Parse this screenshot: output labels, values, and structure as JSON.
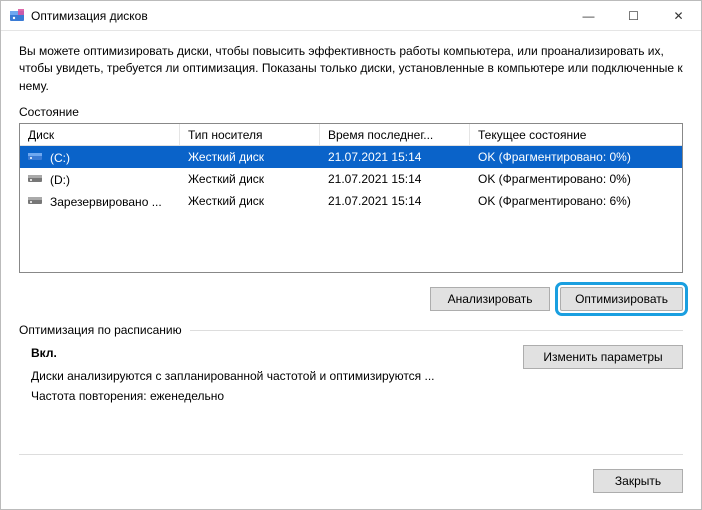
{
  "window": {
    "title": "Оптимизация дисков",
    "minimize_glyph": "—",
    "maximize_glyph": "☐",
    "close_glyph": "✕"
  },
  "description": "Вы можете оптимизировать диски, чтобы повысить эффективность работы компьютера, или проанализировать их, чтобы увидеть, требуется ли оптимизация. Показаны только диски, установленные в компьютере или подключенные к нему.",
  "status_label": "Состояние",
  "columns": {
    "disk": "Диск",
    "media": "Тип носителя",
    "time": "Время последнег...",
    "status": "Текущее состояние"
  },
  "rows": [
    {
      "icon": "drive-c",
      "disk": "(C:)",
      "media": "Жесткий диск",
      "time": "21.07.2021 15:14",
      "status": "OK (Фрагментировано: 0%)",
      "selected": true
    },
    {
      "icon": "drive",
      "disk": "(D:)",
      "media": "Жесткий диск",
      "time": "21.07.2021 15:14",
      "status": "OK (Фрагментировано: 0%)",
      "selected": false
    },
    {
      "icon": "drive",
      "disk": "Зарезервировано ...",
      "media": "Жесткий диск",
      "time": "21.07.2021 15:14",
      "status": "OK (Фрагментировано: 6%)",
      "selected": false
    }
  ],
  "buttons": {
    "analyze": "Анализировать",
    "optimize": "Оптимизировать",
    "change_settings": "Изменить параметры",
    "close": "Закрыть"
  },
  "schedule": {
    "heading": "Оптимизация по расписанию",
    "on_label": "Вкл.",
    "line1": "Диски анализируются с запланированной частотой и оптимизируются ...",
    "line2": "Частота повторения: еженедельно"
  }
}
